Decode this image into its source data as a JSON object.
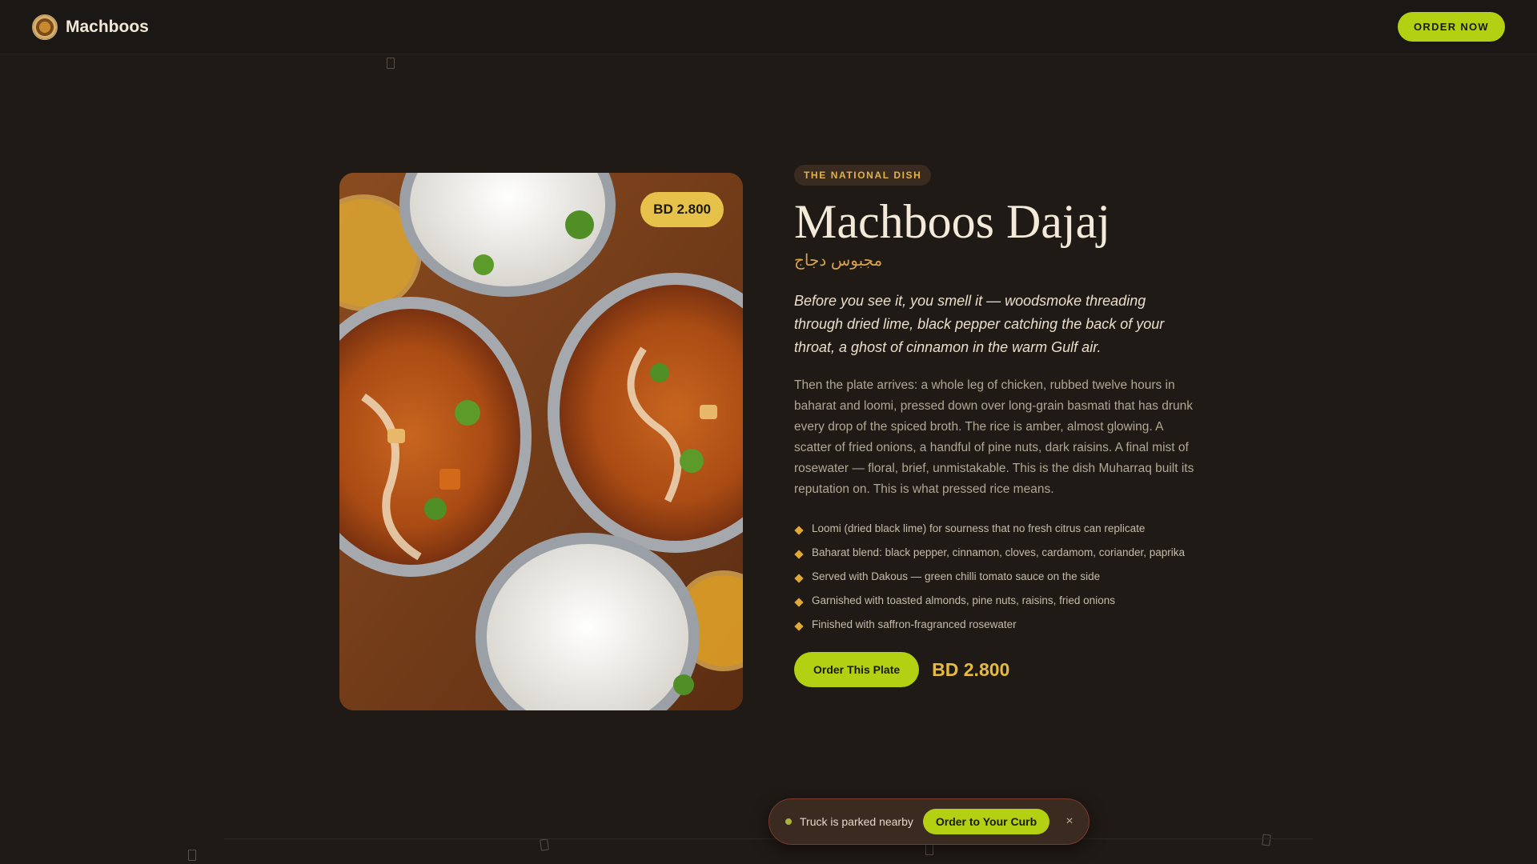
{
  "header": {
    "brand": "Machboos",
    "order_now": "ORDER NOW"
  },
  "hero": {
    "price_badge": "BD 2.800"
  },
  "dish": {
    "tag": "THE NATIONAL DISH",
    "title": "Machboos Dajaj",
    "arabic": "مجبوس دجاج",
    "lead": "Before you see it, you smell it — woodsmoke threading through dried lime, black pepper catching the back of your throat, a ghost of cinnamon in the warm Gulf air.",
    "body": "Then the plate arrives: a whole leg of chicken, rubbed twelve hours in baharat and loomi, pressed down over long-grain basmati that has drunk every drop of the spiced broth. The rice is amber, almost glowing. A scatter of fried onions, a handful of pine nuts, dark raisins. A final mist of rosewater — floral, brief, unmistakable. This is the dish Muharraq built its reputation on. This is what pressed rice means.",
    "features": [
      "Loomi (dried black lime) for sourness that no fresh citrus can replicate",
      "Baharat blend: black pepper, cinnamon, cloves, cardamom, coriander, paprika",
      "Served with Dakous — green chilli tomato sauce on the side",
      "Garnished with toasted almonds, pine nuts, raisins, fried onions",
      "Finished with saffron-fragranced rosewater"
    ],
    "order_button": "Order This Plate",
    "price": "BD 2.800"
  },
  "toast": {
    "text": "Truck is parked nearby",
    "button": "Order to Your Curb",
    "close": "×"
  },
  "colors": {
    "accent": "#b3d012",
    "gold": "#e6b940",
    "background": "#1f1a16"
  }
}
